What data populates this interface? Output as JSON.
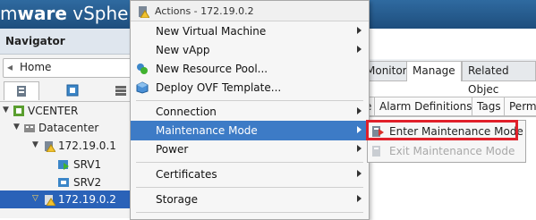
{
  "banner": {
    "brand_prefix": "m",
    "brand_ware": "ware",
    "brand_product": " vSphere"
  },
  "navigator": {
    "title": "Navigator",
    "home_label": "Home",
    "tree": [
      {
        "label": "VCENTER"
      },
      {
        "label": "Datacenter"
      },
      {
        "label": "172.19.0.1"
      },
      {
        "label": "SRV1"
      },
      {
        "label": "SRV2"
      },
      {
        "label": "172.19.0.2"
      }
    ]
  },
  "content": {
    "tabs": [
      "Monitor",
      "Manage",
      "Related Objec"
    ],
    "subtabs": [
      "e",
      "Alarm Definitions",
      "Tags",
      "Perm"
    ]
  },
  "actions_menu": {
    "header": "Actions - 172.19.0.2",
    "items": [
      {
        "label": "New Virtual Machine"
      },
      {
        "label": "New vApp"
      },
      {
        "label": "New Resource Pool..."
      },
      {
        "label": "Deploy OVF Template..."
      },
      {
        "label": "Connection"
      },
      {
        "label": "Maintenance Mode"
      },
      {
        "label": "Power"
      },
      {
        "label": "Certificates"
      },
      {
        "label": "Storage"
      }
    ]
  },
  "maintenance_submenu": {
    "items": [
      {
        "label": "Enter Maintenance Mode",
        "enabled": true
      },
      {
        "label": "Exit Maintenance Mode",
        "enabled": false
      }
    ]
  },
  "colors": {
    "selection": "#2a62b8",
    "menu_hover": "#3d7bc6",
    "highlight_border": "#e0202a"
  }
}
